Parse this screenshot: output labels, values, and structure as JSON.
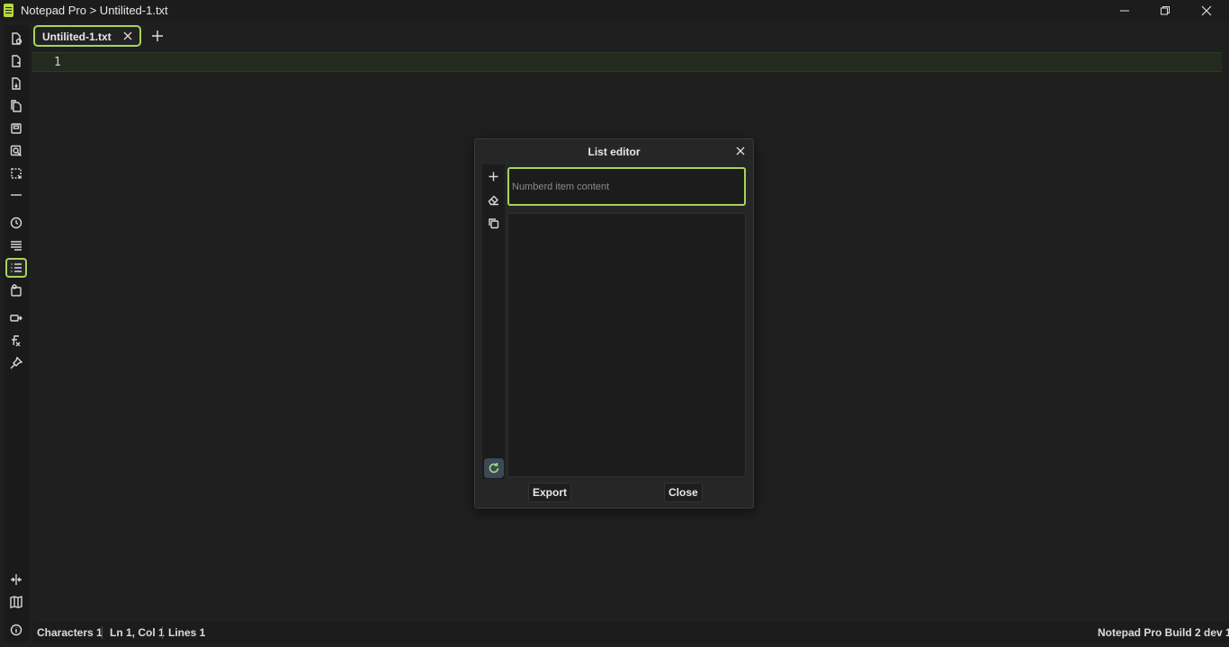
{
  "window": {
    "title": "Notepad Pro > Untilited-1.txt",
    "minimize_icon": "minimize-icon",
    "maximize_icon": "restore-icon",
    "close_icon": "close-icon",
    "accent_color": "#a8d45a"
  },
  "toolbar": {
    "items": [
      {
        "name": "new-file-icon"
      },
      {
        "name": "open-file-icon"
      },
      {
        "name": "save-file-icon"
      },
      {
        "name": "copy-file-icon"
      },
      {
        "name": "save-icon"
      },
      {
        "name": "find-icon"
      },
      {
        "name": "select-area-icon"
      },
      {
        "name": "horizontal-line-icon"
      },
      {
        "name": "history-icon"
      },
      {
        "name": "wrap-text-icon"
      },
      {
        "name": "list-editor-icon",
        "active": true
      },
      {
        "name": "file-info-icon"
      },
      {
        "name": "insert-icon"
      },
      {
        "name": "formula-icon"
      },
      {
        "name": "pin-icon"
      }
    ],
    "bottom_items": [
      {
        "name": "split-view-icon"
      },
      {
        "name": "map-icon"
      },
      {
        "name": "info-icon"
      }
    ]
  },
  "tabs": [
    {
      "label": "Untilited-1.txt",
      "active": true
    }
  ],
  "editor": {
    "line_numbers": [
      "1"
    ]
  },
  "list_editor": {
    "title": "List editor",
    "input_placeholder": "Numberd item content",
    "input_value": "",
    "side_buttons": [
      "add-icon",
      "eraser-icon",
      "copy-icon"
    ],
    "refresh_icon": "refresh-icon",
    "export_label": "Export",
    "close_label": "Close"
  },
  "status": {
    "characters": "Characters 1",
    "position": "Ln 1, Col 1",
    "lines": "Lines 1",
    "build": "Notepad Pro Build 2 dev 1"
  }
}
